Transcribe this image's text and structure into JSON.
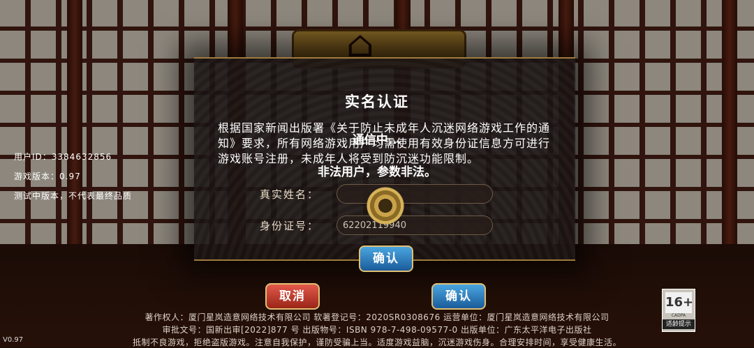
{
  "side_info": {
    "user_id": "用户ID：3384632856",
    "game_version": "游戏版本：0.97",
    "test_note": "测试中版本，不代表最终品质"
  },
  "dialog": {
    "title": "实名认证",
    "notice": "根据国家新闻出版署《关于防止未成年人沉迷网络游戏工作的通知》要求，所有网络游戏用户均需使用有效身份证信息方可进行游戏账号注册，未成年人将受到防沉迷功能限制。",
    "name_label": "真实姓名：",
    "name_value": "",
    "id_label": "身份证号：",
    "id_value": "62202119940",
    "confirm_label": "确认"
  },
  "overlay": {
    "connecting": "通信中...",
    "error": "非法用户，参数非法。"
  },
  "buttons": {
    "cancel": "取消",
    "confirm": "确认"
  },
  "footer": {
    "line1": "著作权人：厦门星岚造意网络技术有限公司   软著登记号：2020SR0308676   运营单位：厦门星岚造意网络技术有限公司",
    "line2": "审批文号：国新出审[2022]877 号  出版物号：ISBN 978-7-498-09577-0  出版单位：广东太平洋电子出版社",
    "line3": "抵制不良游戏，拒绝盗版游戏。注意自我保护，谨防受骗上当。适度游戏益脑，沉迷游戏伤身。合理安排时间，享受健康生活。"
  },
  "version": "V0.97",
  "age_rating": {
    "number": "16+",
    "org": "CADPA",
    "tip": "适龄提示"
  }
}
